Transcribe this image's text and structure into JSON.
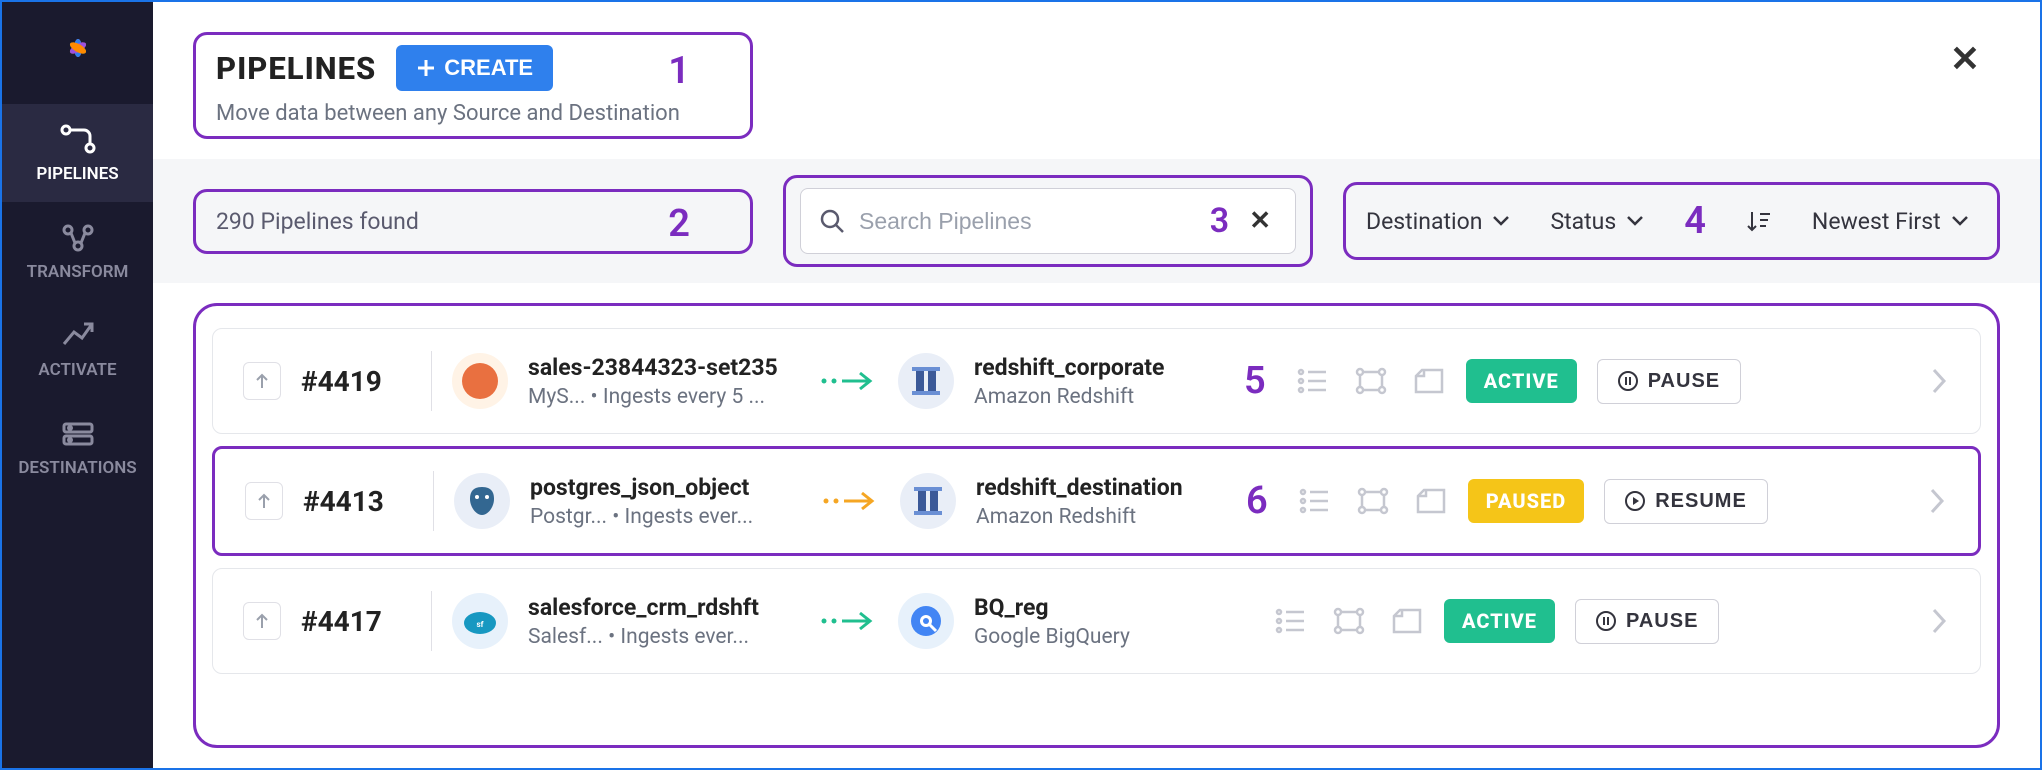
{
  "sidebar": {
    "items": [
      {
        "label": "PIPELINES"
      },
      {
        "label": "TRANSFORM"
      },
      {
        "label": "ACTIVATE"
      },
      {
        "label": "DESTINATIONS"
      }
    ]
  },
  "header": {
    "title": "PIPELINES",
    "create_label": "CREATE",
    "subtitle": "Move data between any Source and Destination",
    "annotation": "1"
  },
  "toolbar": {
    "count_text": "290 Pipelines found",
    "count_annotation": "2",
    "search_placeholder": "Search Pipelines",
    "search_annotation": "3",
    "filter_destination": "Destination",
    "filter_status": "Status",
    "sort_label": "Newest First",
    "filters_annotation": "4"
  },
  "pipelines": [
    {
      "id": "#4419",
      "source_name": "sales-23844323-set235",
      "source_sub": "MyS...  • Ingests every 5 ...",
      "dest_name": "redshift_corporate",
      "dest_sub": "Amazon Redshift",
      "annotation": "5",
      "status": "ACTIVE",
      "action": "PAUSE",
      "arrow_color": "#20bf8f"
    },
    {
      "id": "#4413",
      "source_name": "postgres_json_object",
      "source_sub": "Postgr...  • Ingests ever...",
      "dest_name": "redshift_destination",
      "dest_sub": "Amazon Redshift",
      "annotation": "6",
      "status": "PAUSED",
      "action": "RESUME",
      "arrow_color": "#f5a623"
    },
    {
      "id": "#4417",
      "source_name": "salesforce_crm_rdshft",
      "source_sub": "Salesf...  • Ingests ever...",
      "dest_name": "BQ_reg",
      "dest_sub": "Google BigQuery",
      "annotation": "",
      "status": "ACTIVE",
      "action": "PAUSE",
      "arrow_color": "#20bf8f"
    }
  ]
}
